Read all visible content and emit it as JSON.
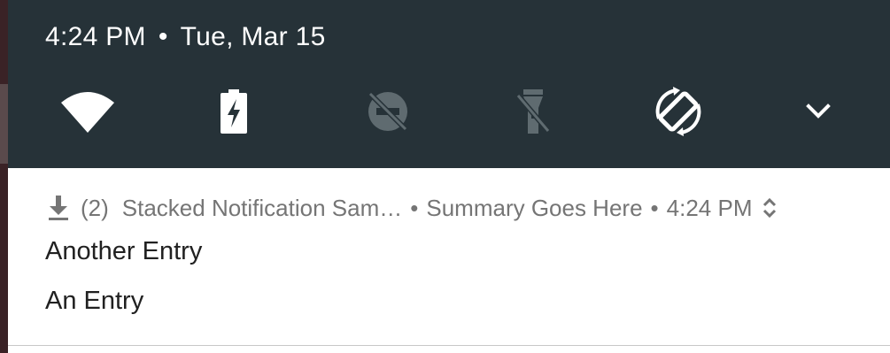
{
  "status_bar": {
    "time": "4:24 PM",
    "separator": "•",
    "date": "Tue, Mar 15"
  },
  "quick_settings": [
    {
      "name": "wifi",
      "icon": "wifi-icon",
      "active": true
    },
    {
      "name": "battery",
      "icon": "battery-charging-icon",
      "active": true
    },
    {
      "name": "do-not-disturb",
      "icon": "do-not-disturb-off-icon",
      "active": false
    },
    {
      "name": "flashlight",
      "icon": "flashlight-off-icon",
      "active": false
    },
    {
      "name": "auto-rotate",
      "icon": "auto-rotate-icon",
      "active": true
    },
    {
      "name": "expand",
      "icon": "chevron-down-icon",
      "active": true
    }
  ],
  "notification": {
    "icon": "download-icon",
    "count": "(2)",
    "app_name": "Stacked Notification Sam…",
    "separator": "•",
    "summary": "Summary Goes Here",
    "time": "4:24 PM",
    "expand_icon": "expand-collapse-icon",
    "entries": [
      "Another Entry",
      "An Entry"
    ]
  },
  "colors": {
    "shade_background": "#263238",
    "notification_background": "#ffffff",
    "header_text": "#757575",
    "entry_text": "#212121",
    "inactive_icon": "#5f6b70"
  }
}
